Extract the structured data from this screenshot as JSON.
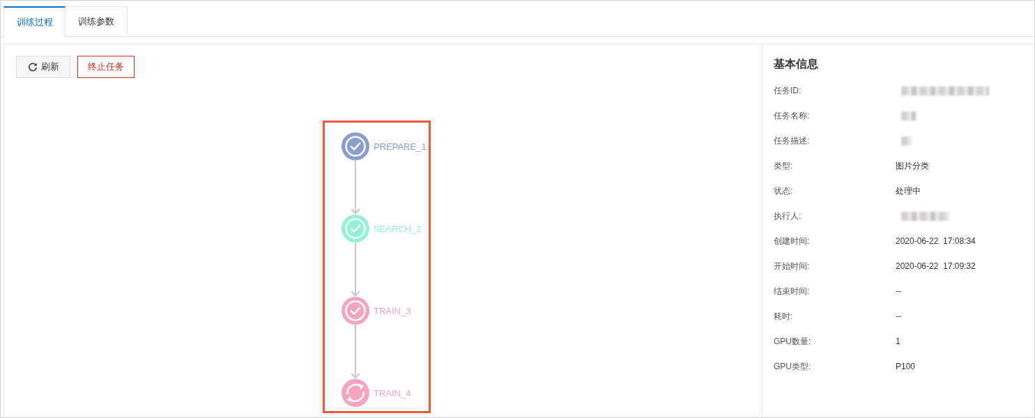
{
  "tabs": [
    {
      "label": "训练过程",
      "selected": true
    },
    {
      "label": "训练参数",
      "selected": false
    }
  ],
  "toolbar": {
    "buttons": [
      {
        "label": "刷新",
        "kind": "refresh"
      },
      {
        "label": "终止任务",
        "kind": "danger"
      }
    ]
  },
  "diagram": {
    "highlighted": true,
    "nodes": [
      {
        "label": "PREPARE_1",
        "kind": "done",
        "color": "#8b9dcf"
      },
      {
        "label": "SEARCH_2",
        "kind": "done",
        "color": "#93f1d5"
      },
      {
        "label": "TRAIN_3",
        "kind": "done",
        "color": "#f6a5c0"
      },
      {
        "label": "TRAIN_4",
        "kind": "running",
        "color": "#f6a5c0"
      }
    ]
  },
  "info_panel": {
    "title": "基本信息",
    "rows": [
      {
        "label": "任务ID:",
        "kind": "redacted"
      },
      {
        "label": "任务名称:",
        "kind": "redacted"
      },
      {
        "label": "任务描述:",
        "kind": "redacted"
      },
      {
        "label": "类型:",
        "kind": "text",
        "value": "图片分类"
      },
      {
        "label": "状态:",
        "kind": "text",
        "value": "处理中"
      },
      {
        "label": "执行人:",
        "kind": "redacted"
      },
      {
        "label": "创建时间:",
        "kind": "text",
        "value": "2020-06-22  17:08:34"
      },
      {
        "label": "开始时间:",
        "kind": "text",
        "value": "2020-06-22  17:09:32"
      },
      {
        "label": "结束时间:",
        "kind": "text",
        "value": "--"
      },
      {
        "label": "耗时:",
        "kind": "text",
        "value": "--"
      },
      {
        "label": "GPU数量:",
        "kind": "text",
        "value": "1"
      },
      {
        "label": "GPU类型:",
        "kind": "text",
        "value": "P100"
      }
    ]
  }
}
